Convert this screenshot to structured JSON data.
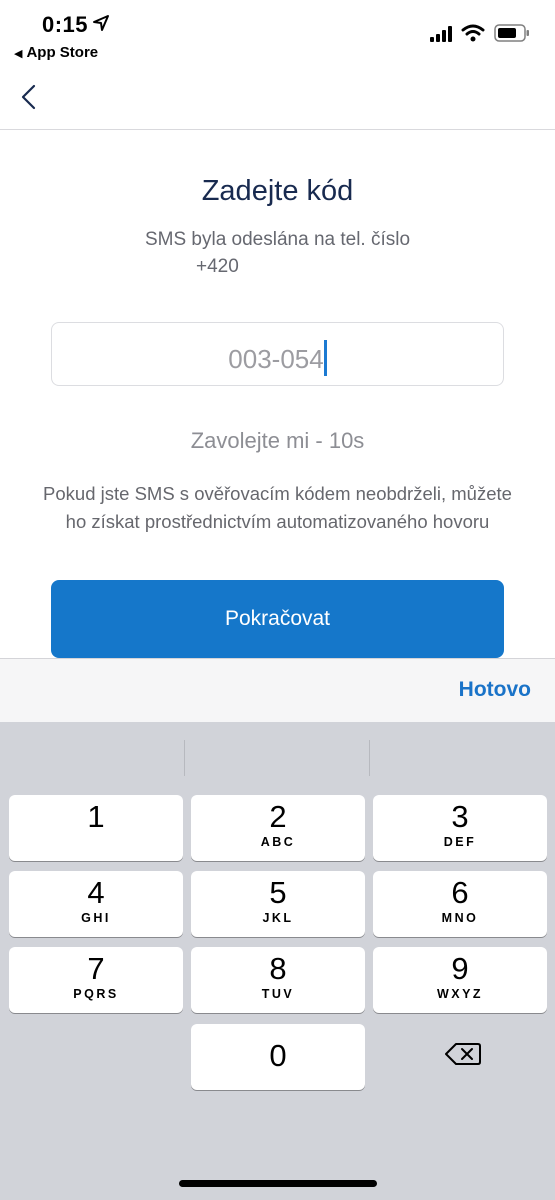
{
  "status_bar": {
    "time": "0:15",
    "back_app_label": "App Store",
    "icons": [
      "location-arrow-icon",
      "cellular-signal-icon",
      "wifi-icon",
      "battery-icon"
    ]
  },
  "nav": {
    "back_icon": "chevron-left-icon"
  },
  "content": {
    "title": "Zadejte kód",
    "subtitle": "SMS byla odeslána na tel. číslo",
    "phone": "+420",
    "code_value": "003-054",
    "call_me": "Zavolejte mi - 10s",
    "info": "Pokud jste SMS s ověřovacím kódem neobdrželi, můžete ho získat prostřednictvím automatizovaného hovoru",
    "continue_label": "Pokračovat"
  },
  "accessory": {
    "done_label": "Hotovo"
  },
  "keyboard": {
    "keys": [
      {
        "num": "1",
        "letters": ""
      },
      {
        "num": "2",
        "letters": "ABC"
      },
      {
        "num": "3",
        "letters": "DEF"
      },
      {
        "num": "4",
        "letters": "GHI"
      },
      {
        "num": "5",
        "letters": "JKL"
      },
      {
        "num": "6",
        "letters": "MNO"
      },
      {
        "num": "7",
        "letters": "PQRS"
      },
      {
        "num": "8",
        "letters": "TUV"
      },
      {
        "num": "9",
        "letters": "WXYZ"
      },
      {
        "num": "0",
        "letters": ""
      }
    ],
    "delete_icon": "backspace-icon"
  },
  "colors": {
    "primary_button": "#1577ca",
    "title_text": "#182a4f",
    "done_text": "#1a73c8",
    "caret": "#1c7ad2"
  }
}
